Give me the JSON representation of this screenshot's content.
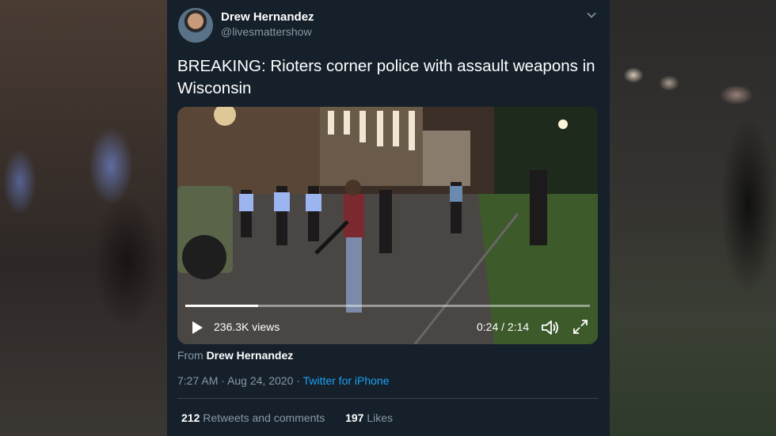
{
  "author": {
    "name": "Drew Hernandez",
    "handle": "@livesmattershow"
  },
  "tweet": {
    "text": "BREAKING: Rioters corner police with assault weapons in Wisconsin"
  },
  "video": {
    "views": "236.3K views",
    "timecode": "0:24 / 2:14",
    "progress": 0.18
  },
  "from": {
    "prefix": "From",
    "name": "Drew Hernandez"
  },
  "meta": {
    "time": "7:27 AM",
    "separator": "·",
    "date": "Aug 24, 2020",
    "source": "Twitter for iPhone"
  },
  "stats": {
    "retweets_count": "212",
    "retweets_label": "Retweets and comments",
    "likes_count": "197",
    "likes_label": "Likes"
  },
  "icons": {
    "play": "play-icon",
    "volume": "volume-icon",
    "fullscreen": "fullscreen-icon",
    "caret": "chevron-down-icon"
  },
  "colors": {
    "card_bg": "#15202b",
    "secondary_text": "#8899a6",
    "link": "#1da1f2",
    "divider": "#38444d"
  }
}
